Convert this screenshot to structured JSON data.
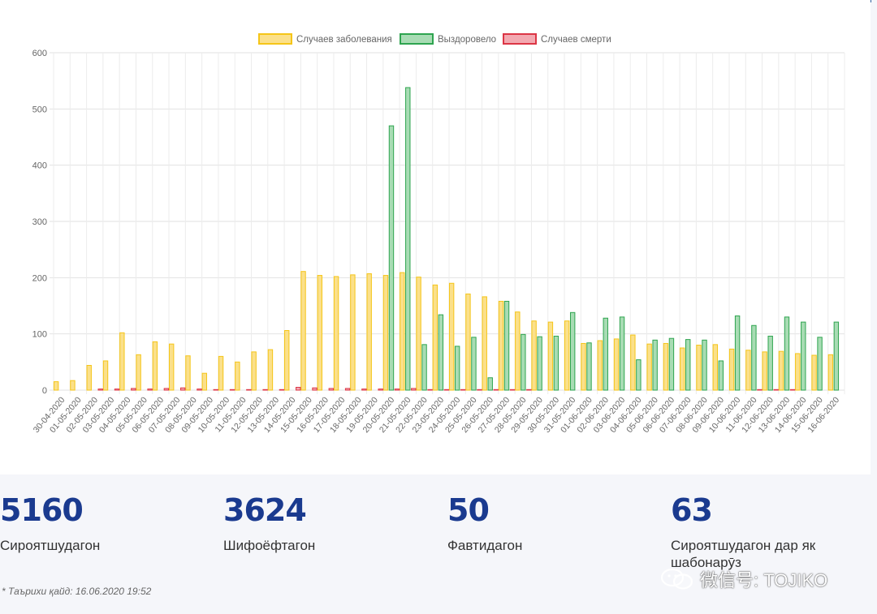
{
  "chart_data": {
    "type": "bar",
    "categories": [
      "30-04-2020",
      "01-05-2020",
      "02-05-2020",
      "03-05-2020",
      "04-05-2020",
      "05-05-2020",
      "06-05-2020",
      "07-05-2020",
      "08-05-2020",
      "09-05-2020",
      "10-05-2020",
      "11-05-2020",
      "12-05-2020",
      "13-05-2020",
      "14-05-2020",
      "15-05-2020",
      "16-05-2020",
      "17-05-2020",
      "18-05-2020",
      "19-05-2020",
      "20-05-2020",
      "21-05-2020",
      "22-05-2020",
      "23-05-2020",
      "24-05-2020",
      "25-05-2020",
      "26-05-2020",
      "27-05-2020",
      "28-05-2020",
      "29-05-2020",
      "30-05-2020",
      "31-05-2020",
      "01-06-2020",
      "02-06-2020",
      "03-06-2020",
      "04-06-2020",
      "05-06-2020",
      "06-06-2020",
      "07-06-2020",
      "08-06-2020",
      "09-06-2020",
      "10-06-2020",
      "11-06-2020",
      "12-06-2020",
      "13-06-2020",
      "14-06-2020",
      "15-06-2020",
      "16-06-2020"
    ],
    "series": [
      {
        "name": "Случаев заболевания",
        "color": "#f5c518",
        "fill": "#fbe08a",
        "values": [
          15,
          17,
          44,
          52,
          102,
          63,
          86,
          82,
          61,
          30,
          60,
          50,
          68,
          72,
          106,
          211,
          204,
          202,
          205,
          207,
          204,
          209,
          201,
          187,
          190,
          171,
          166,
          158,
          139,
          123,
          121,
          123,
          83,
          88,
          91,
          98,
          82,
          83,
          75,
          80,
          81,
          73,
          71,
          68,
          69,
          65,
          62,
          63
        ]
      },
      {
        "name": "Выздоровело",
        "color": "#2ea44f",
        "fill": "#a8dcb4",
        "values": [
          0,
          0,
          0,
          0,
          0,
          0,
          0,
          0,
          0,
          0,
          0,
          0,
          0,
          0,
          0,
          0,
          0,
          0,
          0,
          0,
          470,
          538,
          81,
          134,
          78,
          94,
          22,
          158,
          99,
          95,
          96,
          138,
          84,
          128,
          130,
          54,
          89,
          92,
          90,
          89,
          52,
          132,
          115,
          96,
          130,
          121,
          94,
          121
        ]
      },
      {
        "name": "Случаев смерти",
        "color": "#dc3545",
        "fill": "#f3a9b1",
        "values": [
          0,
          0,
          2,
          2,
          3,
          2,
          3,
          4,
          2,
          1,
          1,
          1,
          1,
          1,
          5,
          4,
          3,
          3,
          2,
          2,
          2,
          3,
          1,
          1,
          1,
          1,
          1,
          1,
          1,
          0,
          0,
          0,
          0,
          0,
          0,
          0,
          0,
          0,
          0,
          0,
          0,
          0,
          1,
          1,
          1,
          0,
          0,
          0
        ]
      }
    ],
    "ylim": [
      0,
      600
    ],
    "y_ticks": [
      0,
      100,
      200,
      300,
      400,
      500,
      600
    ],
    "grid": true,
    "legend": "top-center"
  },
  "stats": [
    {
      "value": "5160",
      "label": "Сироятшудагон"
    },
    {
      "value": "3624",
      "label": "Шифоёфтагон"
    },
    {
      "value": "50",
      "label": "Фавтидагон"
    },
    {
      "value": "63",
      "label": "Сироятшудагон дар як шабонарӯз"
    }
  ],
  "updated": "* Таърихи қайд: 16.06.2020 19:52",
  "watermark": {
    "text": "微信号: TOJIKO",
    "icon": "wechat-logo-icon"
  }
}
